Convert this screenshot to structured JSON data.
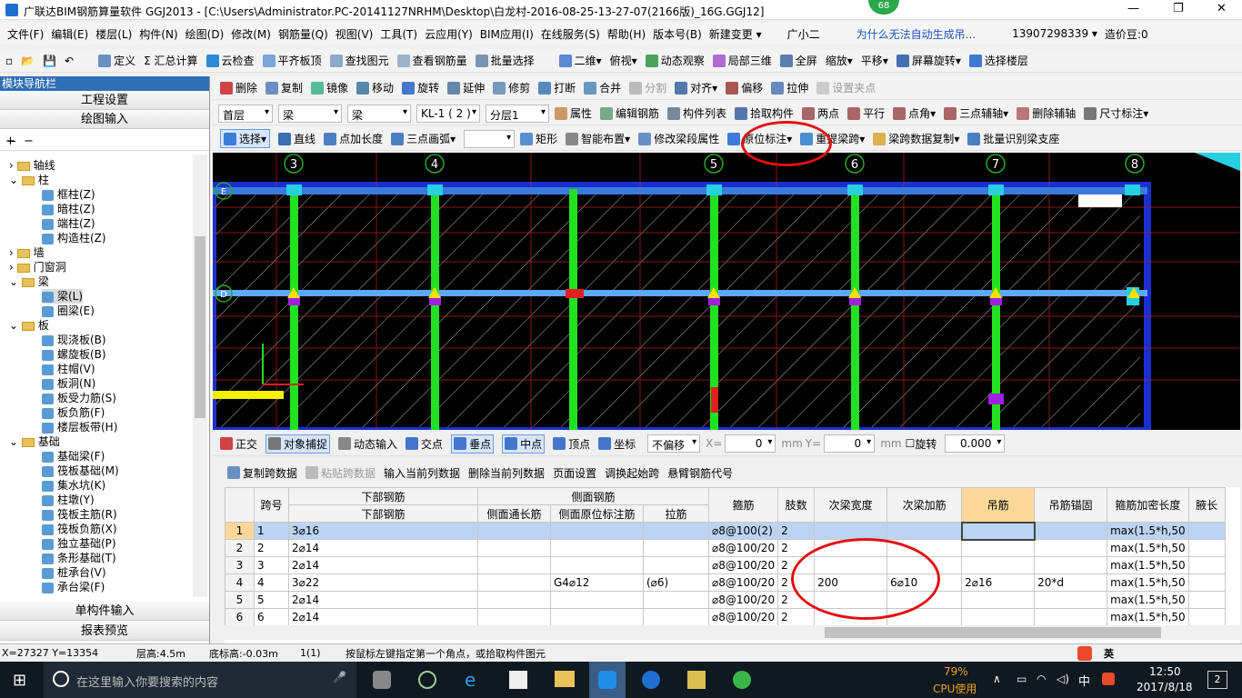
{
  "window": {
    "title": "广联达BIM钢筋算量软件 GGJ2013 - [C:\\Users\\Administrator.PC-20141127NRHM\\Desktop\\白龙村-2016-08-25-13-27-07(2166版)_16G.GGJ12]",
    "badge": "68"
  },
  "menu": [
    "文件(F)",
    "编辑(E)",
    "楼层(L)",
    "构件(N)",
    "绘图(D)",
    "修改(M)",
    "钢筋量(Q)",
    "视图(V)",
    "工具(T)",
    "云应用(Y)",
    "BIM应用(I)",
    "在线服务(S)",
    "帮助(H)",
    "版本号(B)",
    "新建变更 ▾",
    "广小二",
    "为什么无法自动生成吊...",
    "13907298339 ▾",
    "造价豆:0"
  ],
  "toolbar1": [
    "定义",
    "Σ 汇总计算",
    "云检查",
    "平齐板顶",
    "查找图元",
    "查看钢筋量",
    "批量选择",
    "二维",
    "俯视",
    "动态观察",
    "局部三维",
    "全屏",
    "缩放",
    "平移",
    "屏幕旋转",
    "选择楼层"
  ],
  "toolbar2": [
    "删除",
    "复制",
    "镜像",
    "移动",
    "旋转",
    "延伸",
    "修剪",
    "打断",
    "合并",
    "分割",
    "对齐",
    "偏移",
    "拉伸",
    "设置夹点"
  ],
  "toolbar3": {
    "combos": [
      "首层",
      "梁",
      "梁",
      "KL-1 ( 2 )",
      "分层1"
    ],
    "items": [
      "属性",
      "编辑钢筋",
      "构件列表",
      "拾取构件",
      "两点",
      "平行",
      "点角",
      "三点辅轴",
      "删除辅轴",
      "尺寸标注"
    ]
  },
  "toolbar4": [
    "选择",
    "直线",
    "点加长度",
    "三点画弧",
    "矩形",
    "智能布置",
    "修改梁段属性",
    "原位标注",
    "重提梁跨",
    "梁跨数据复制",
    "批量识别梁支座"
  ],
  "leftpanel": {
    "title": "模块导航栏",
    "buttons": [
      "工程设置",
      "绘图输入"
    ],
    "bottom_buttons": [
      "单构件输入",
      "报表预览"
    ],
    "tree": [
      "轴线",
      "柱",
      "框柱(Z)",
      "暗柱(Z)",
      "端柱(Z)",
      "构造柱(Z)",
      "墙",
      "门窗洞",
      "梁",
      "梁(L)",
      "圈梁(E)",
      "板",
      "现浇板(B)",
      "螺旋板(B)",
      "柱帽(V)",
      "板洞(N)",
      "板受力筋(S)",
      "板负筋(F)",
      "楼层板带(H)",
      "基础",
      "基础梁(F)",
      "筏板基础(M)",
      "集水坑(K)",
      "柱墩(Y)",
      "筏板主筋(R)",
      "筏板负筋(X)",
      "独立基础(P)",
      "条形基础(T)",
      "桩承台(V)",
      "承台梁(F)"
    ]
  },
  "canvas": {
    "axes": [
      "3",
      "4",
      "5",
      "6",
      "7",
      "8"
    ],
    "rows": [
      "E",
      "D"
    ]
  },
  "snapbar": {
    "items": [
      "正交",
      "对象捕捉",
      "动态输入",
      "交点",
      "垂点",
      "中点",
      "顶点",
      "坐标"
    ],
    "offset": "不偏移",
    "x_label": "X=",
    "x_val": "0",
    "y_label": "Y=",
    "y_val": "0",
    "unit": "mm",
    "rotate": "旋转",
    "rotate_val": "0.000"
  },
  "gridbar": [
    "复制跨数据",
    "粘贴跨数据",
    "输入当前列数据",
    "删除当前列数据",
    "页面设置",
    "调换起始跨",
    "悬臂钢筋代号"
  ],
  "table": {
    "group_headers": [
      "跨号",
      "下部钢筋",
      "侧面钢筋",
      "箍筋",
      "肢数",
      "次梁宽度",
      "次梁加筋",
      "吊筋",
      "吊筋锚固",
      "箍筋加密长度",
      "腋长"
    ],
    "sub_headers": [
      "下部钢筋",
      "侧面通长筋",
      "侧面原位标注筋",
      "拉筋"
    ],
    "rows": [
      {
        "n": "1",
        "span": "1",
        "bottom": "3⌀16",
        "side_long": "",
        "side_orig": "",
        "tie": "",
        "stirrup": "⌀8@100(2)",
        "legs": "2",
        "sb_w": "",
        "sb_add": "",
        "hang": "",
        "anchor": "",
        "dense": "max(1.5*h,50"
      },
      {
        "n": "2",
        "span": "2",
        "bottom": "2⌀14",
        "side_long": "",
        "side_orig": "",
        "tie": "",
        "stirrup": "⌀8@100/20",
        "legs": "2",
        "sb_w": "",
        "sb_add": "",
        "hang": "",
        "anchor": "",
        "dense": "max(1.5*h,50"
      },
      {
        "n": "3",
        "span": "3",
        "bottom": "2⌀14",
        "side_long": "",
        "side_orig": "",
        "tie": "",
        "stirrup": "⌀8@100/20",
        "legs": "2",
        "sb_w": "",
        "sb_add": "",
        "hang": "",
        "anchor": "",
        "dense": "max(1.5*h,50"
      },
      {
        "n": "4",
        "span": "4",
        "bottom": "3⌀22",
        "side_long": "",
        "side_orig": "G4⌀12",
        "tie": "(⌀6)",
        "stirrup": "⌀8@100/20",
        "legs": "2",
        "sb_w": "200",
        "sb_add": "6⌀10",
        "hang": "2⌀16",
        "anchor": "20*d",
        "dense": "max(1.5*h,50"
      },
      {
        "n": "5",
        "span": "5",
        "bottom": "2⌀14",
        "side_long": "",
        "side_orig": "",
        "tie": "",
        "stirrup": "⌀8@100/20",
        "legs": "2",
        "sb_w": "",
        "sb_add": "",
        "hang": "",
        "anchor": "",
        "dense": "max(1.5*h,50"
      },
      {
        "n": "6",
        "span": "6",
        "bottom": "2⌀14",
        "side_long": "",
        "side_orig": "",
        "tie": "",
        "stirrup": "⌀8@100/20",
        "legs": "2",
        "sb_w": "",
        "sb_add": "",
        "hang": "",
        "anchor": "",
        "dense": "max(1.5*h,50"
      }
    ]
  },
  "status": {
    "coord": "X=27327 Y=13354",
    "floor_h": "层高:4.5m",
    "bottom_h": "底标高:-0.03m",
    "count": "1(1)",
    "hint": "按鼠标左键指定第一个角点，或拾取构件图元"
  },
  "taskbar": {
    "search": "在这里输入你要搜索的内容",
    "cpu": "79%",
    "cpu_label": "CPU使用",
    "ime": "中",
    "time": "12:50",
    "date": "2017/8/18",
    "notif": "2",
    "ime2": "英"
  }
}
